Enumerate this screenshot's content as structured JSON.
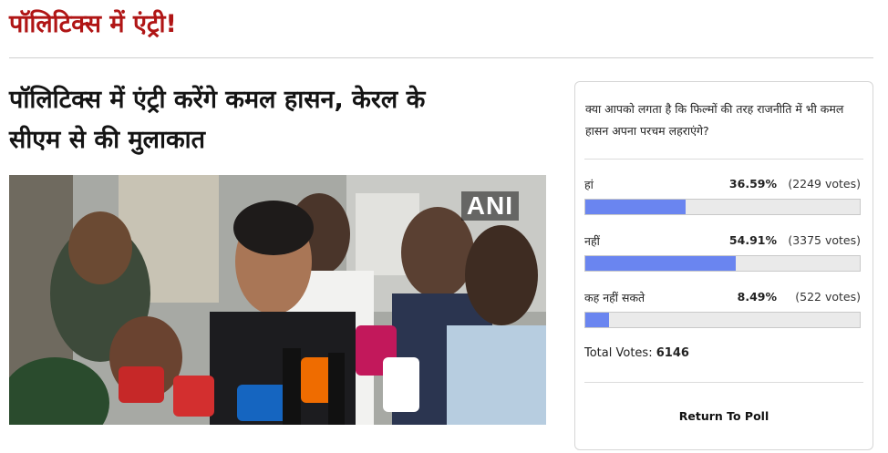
{
  "section": {
    "title": "पॉलिटिक्स में एंट्री!"
  },
  "article": {
    "headline_line1": "पॉलिटिक्स में एंट्री करेंगे कमल हासन, केरल के",
    "headline_line2": "सीएम से की मुलाकात",
    "photo_watermark": "ANI"
  },
  "poll": {
    "question": "क्या आपको लगता है कि फिल्मों की तरह राजनीति में भी कमल हासन अपना परचम लहराएंगे?",
    "options": [
      {
        "label": "हां",
        "percent_text": "36.59%",
        "votes_text": "(2249 votes)",
        "fraction": 0.3659
      },
      {
        "label": "नहीं",
        "percent_text": "54.91%",
        "votes_text": "(3375 votes)",
        "fraction": 0.5491
      },
      {
        "label": "कह नहीं सकते",
        "percent_text": "8.49%",
        "votes_text": "(522 votes)",
        "fraction": 0.0849
      }
    ],
    "total_label": "Total Votes:",
    "total_value": "6146",
    "return_label": "Return To Poll",
    "bar_color": "#6a85f0"
  },
  "colors": {
    "title_red": "#b01515"
  }
}
